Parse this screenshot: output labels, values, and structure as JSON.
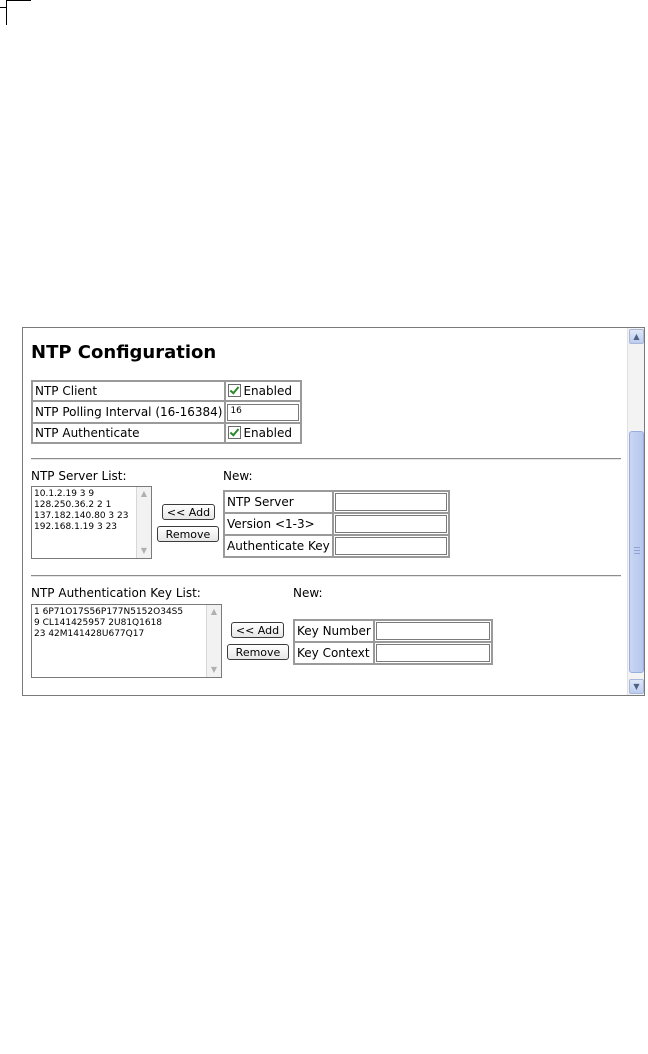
{
  "page": {
    "title": "NTP Configuration"
  },
  "settings": {
    "ntp_client_label": "NTP Client",
    "ntp_client_value": "Enabled",
    "polling_label": "NTP Polling Interval (16-16384)",
    "polling_value": "16",
    "authenticate_label": "NTP Authenticate",
    "authenticate_value": "Enabled"
  },
  "server_list": {
    "label": "NTP Server List:",
    "items": [
      "10.1.2.19 3 9",
      "128.250.36.2 2 1",
      "137.182.140.80 3 23",
      "192.168.1.19 3 23"
    ],
    "add_label": "<< Add",
    "remove_label": "Remove",
    "new_label": "New:",
    "fields": {
      "server": "NTP Server",
      "version": "Version <1-3>",
      "auth_key": "Authenticate Key"
    }
  },
  "auth_key_list": {
    "label": "NTP Authentication Key List:",
    "items": [
      "1 6P71O17S56P177N5152O34S5",
      "9 CL141425957 2U81Q1618",
      "23 42M141428U677Q17"
    ],
    "add_label": "<< Add",
    "remove_label": "Remove",
    "new_label": "New:",
    "fields": {
      "key_number": "Key Number",
      "key_context": "Key Context"
    }
  },
  "icons": {
    "checkbox": "checkmark-icon",
    "scroll_up": "chevron-up-icon",
    "scroll_down": "chevron-down-icon"
  }
}
